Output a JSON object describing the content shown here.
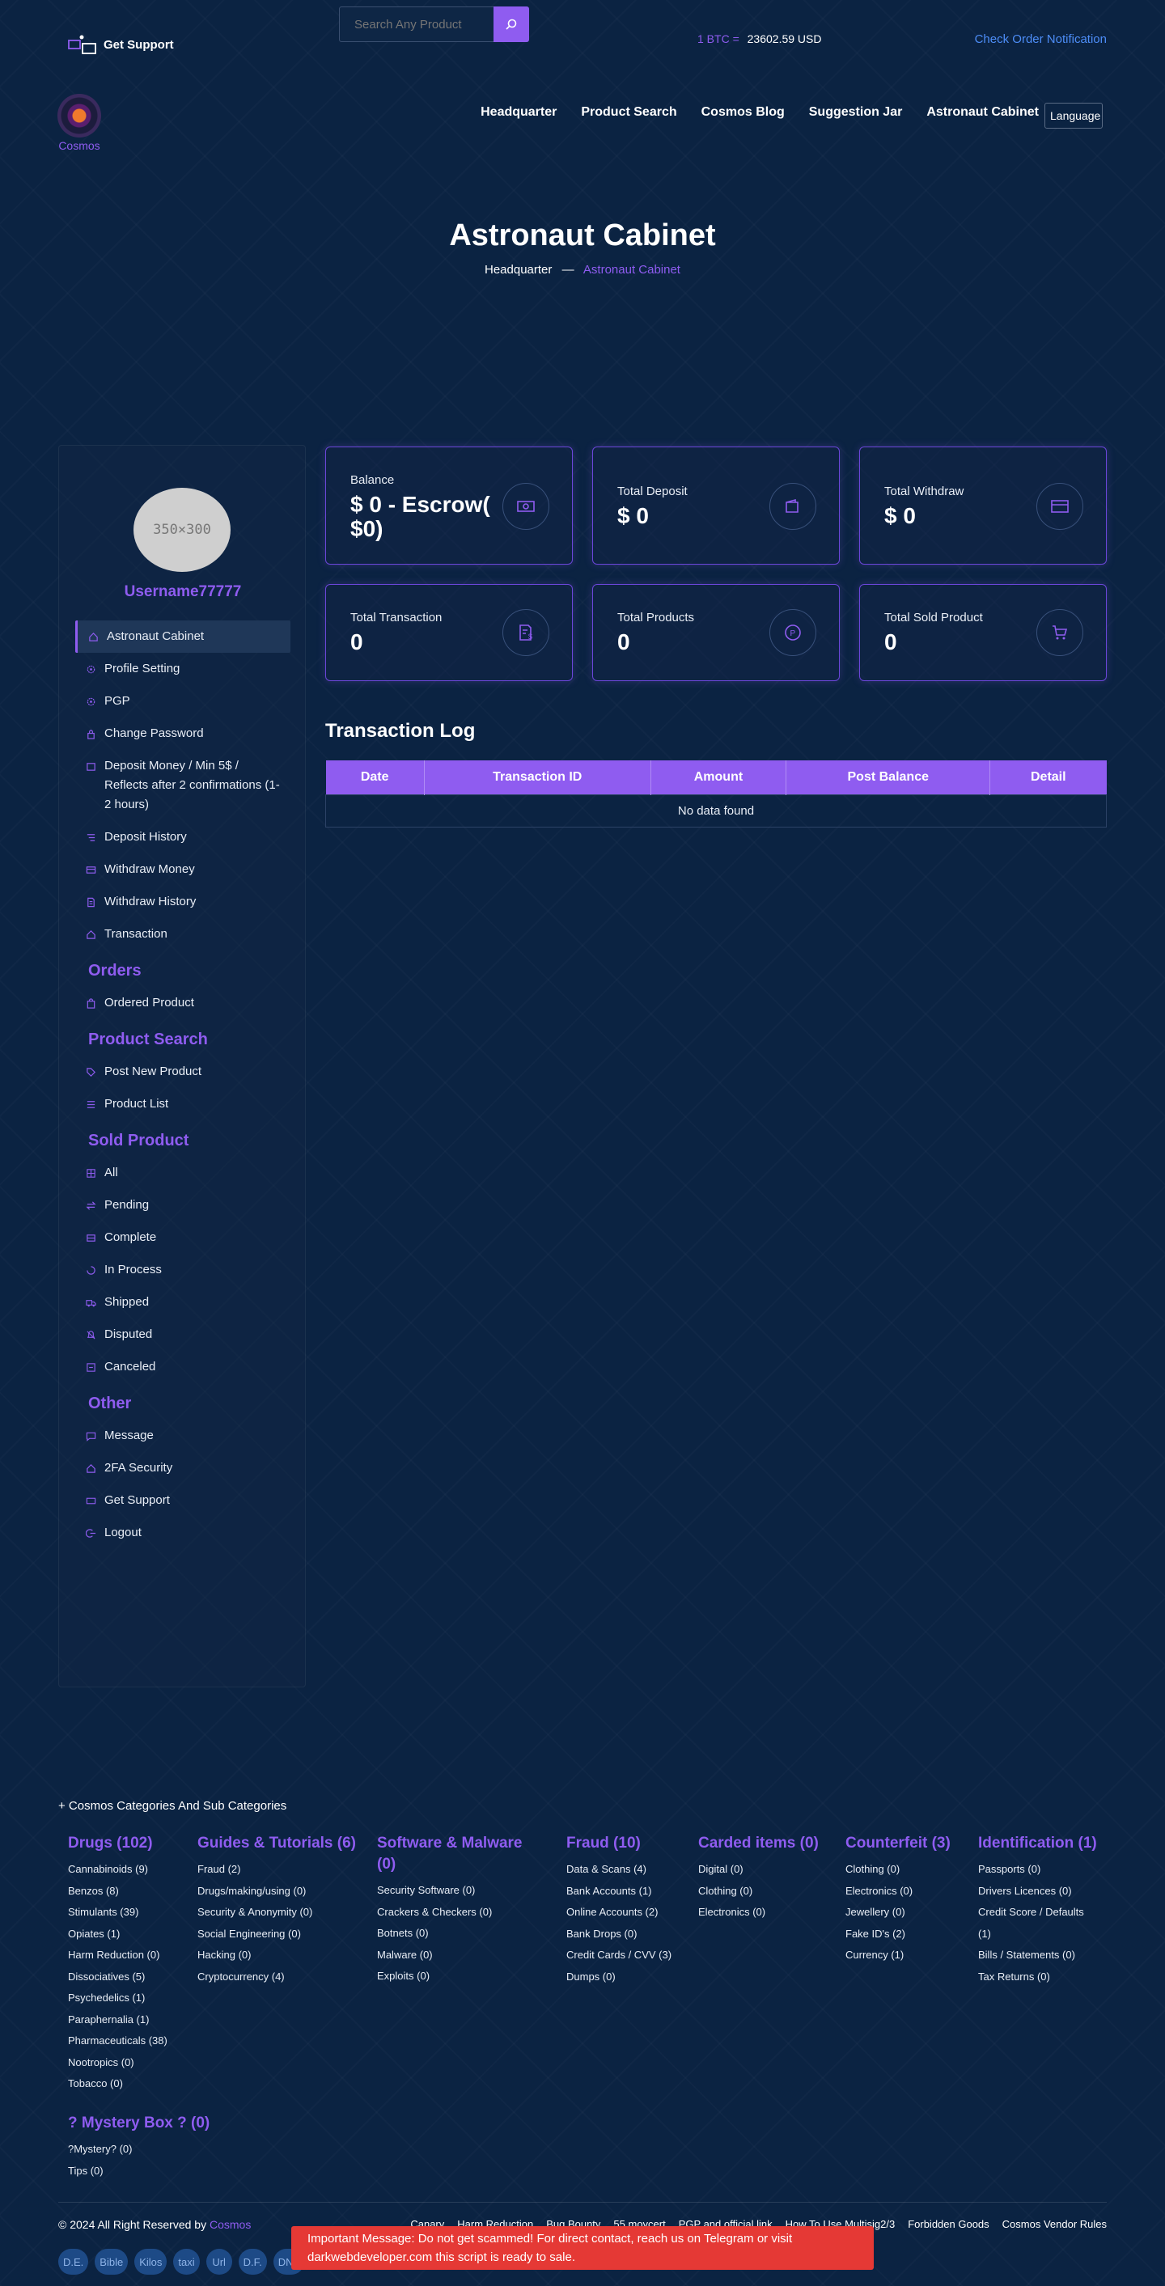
{
  "topbar": {
    "support_label": "Get Support",
    "search_placeholder": "Search Any Product",
    "btc_label": "1 BTC =",
    "btc_value": "23602.59 USD",
    "check_order": "Check Order Notification"
  },
  "nav": {
    "logo_text": "Cosmos",
    "links": [
      "Headquarter",
      "Product Search",
      "Cosmos Blog",
      "Suggestion Jar",
      "Astronaut Cabinet"
    ],
    "language": "Language"
  },
  "hero": {
    "title": "Astronaut Cabinet",
    "crumb_home": "Headquarter",
    "crumb_sep": "—",
    "crumb_current": "Astronaut Cabinet"
  },
  "profile": {
    "avatar_placeholder": "350×300",
    "username": "Username77777"
  },
  "menu": {
    "main": [
      "Astronaut Cabinet",
      "Profile Setting",
      "PGP",
      "Change Password",
      "Deposit Money / Min 5$ / Reflects after 2 confirmations (1-2 hours)",
      "Deposit History",
      "Withdraw Money",
      "Withdraw History",
      "Transaction"
    ],
    "orders_heading": "Orders",
    "orders": [
      "Ordered Product"
    ],
    "product_heading": "Product Search",
    "product": [
      "Post New Product",
      "Product List"
    ],
    "sold_heading": "Sold Product",
    "sold": [
      "All",
      "Pending",
      "Complete",
      "In Process",
      "Shipped",
      "Disputed",
      "Canceled"
    ],
    "other_heading": "Other",
    "other": [
      "Message",
      "2FA Security",
      "Get Support",
      "Logout"
    ]
  },
  "cards": [
    {
      "label": "Balance",
      "value": "$ 0 - Escrow( $0)",
      "icon": "money-icon"
    },
    {
      "label": "Total Deposit",
      "value": "$ 0",
      "icon": "wallet-icon"
    },
    {
      "label": "Total Withdraw",
      "value": "$ 0",
      "icon": "credit-card-icon"
    },
    {
      "label": "Total Transaction",
      "value": "0",
      "icon": "receipt-dollar-icon"
    },
    {
      "label": "Total Products",
      "value": "0",
      "icon": "product-p-icon"
    },
    {
      "label": "Total Sold Product",
      "value": "0",
      "icon": "cart-icon"
    }
  ],
  "transaction_log": {
    "title": "Transaction Log",
    "columns": [
      "Date",
      "Transaction ID",
      "Amount",
      "Post Balance",
      "Detail"
    ],
    "empty": "No data found"
  },
  "footer": {
    "categories_header": "+ Cosmos Categories And Sub Categories",
    "categories": [
      {
        "title": "Drugs (102)",
        "items": [
          "Cannabinoids (9)",
          "Benzos (8)",
          "Stimulants (39)",
          "Opiates (1)",
          "Harm Reduction (0)",
          "Dissociatives (5)",
          "Psychedelics (1)",
          "Paraphernalia (1)",
          "Pharmaceuticals (38)",
          "Nootropics (0)",
          "Tobacco (0)"
        ]
      },
      {
        "title": "Guides & Tutorials (6)",
        "items": [
          "Fraud (2)",
          "Drugs/making/using (0)",
          "Security & Anonymity (0)",
          "Social Engineering (0)",
          "Hacking (0)",
          "Cryptocurrency (4)"
        ]
      },
      {
        "title": "Software & Malware (0)",
        "items": [
          "Security Software (0)",
          "Crackers & Checkers (0)",
          "Botnets (0)",
          "Malware (0)",
          "Exploits (0)"
        ]
      },
      {
        "title": "Fraud (10)",
        "items": [
          "Data & Scans (4)",
          "Bank Accounts (1)",
          "Online Accounts (2)",
          "Bank Drops (0)",
          "Credit Cards / CVV (3)",
          "Dumps (0)"
        ]
      },
      {
        "title": "Carded items (0)",
        "items": [
          "Digital (0)",
          "Clothing (0)",
          "Electronics (0)"
        ]
      },
      {
        "title": "Counterfeit (3)",
        "items": [
          "Clothing (0)",
          "Electronics (0)",
          "Jewellery (0)",
          "Fake ID's (2)",
          "Currency (1)"
        ]
      },
      {
        "title": "Identification (1)",
        "items": [
          "Passports (0)",
          "Drivers Licences (0)",
          "Credit Score / Defaults (1)",
          "Bills / Statements (0)",
          "Tax Returns (0)"
        ]
      }
    ],
    "mystery": {
      "title": "? Mystery Box ? (0)",
      "items": [
        "?Mystery? (0)",
        "Tips (0)"
      ]
    },
    "copyright_prefix": "© 2024 All Right Reserved by",
    "copyright_brand": "Cosmos",
    "links": [
      "Canary",
      "Harm Reduction",
      "Bug Bounty",
      "55 moycert",
      "PGP and official link",
      "How To Use Multisig2/3",
      "Forbidden Goods",
      "Cosmos Vendor Rules"
    ],
    "badges": [
      "D.E.",
      "Bible",
      "Kilos",
      "taxi",
      "Url",
      "D.F.",
      "DNL"
    ]
  },
  "alert": {
    "text": "Important Message: Do not get scammed! For direct contact, reach us on Telegram or visit darkwebdeveloper.com this script is ready to sale."
  },
  "colors": {
    "accent": "#8f5cf0",
    "background": "#0b2342",
    "link": "#4d8df7",
    "alert": "#e53935"
  }
}
